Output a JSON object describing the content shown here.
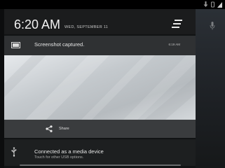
{
  "status_bar": {
    "icons": [
      "download-icon",
      "vibrate-icon",
      "signal-icon"
    ]
  },
  "header": {
    "time": "6:20 AM",
    "date": "WED, SEPTEMBER 11",
    "settings_icon": "quick-settings-icon"
  },
  "notifications": [
    {
      "icon": "screenshot-icon",
      "title": "Screenshot captured.",
      "time": "6:19 AM",
      "action_label": "Share",
      "action_icon": "share-icon"
    },
    {
      "icon": "usb-icon",
      "title": "Connected as a media device",
      "subtitle": "Touch for other USB options."
    }
  ],
  "colors": {
    "background": "#0c0d0e",
    "panel": "#2a2c2e",
    "text": "#e6e6e6"
  }
}
